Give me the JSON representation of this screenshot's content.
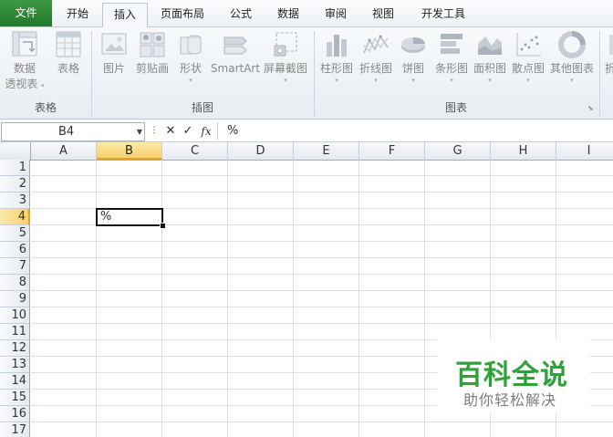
{
  "tabs": {
    "file": "文件",
    "home": "开始",
    "insert": "插入",
    "page_layout": "页面布局",
    "formulas": "公式",
    "data": "数据",
    "review": "审阅",
    "view": "视图",
    "developer": "开发工具"
  },
  "ribbon": {
    "tables": {
      "label": "表格",
      "pivot_line1": "数据",
      "pivot_line2": "透视表",
      "table": "表格"
    },
    "illustrations": {
      "label": "插图",
      "picture": "图片",
      "clipart": "剪贴画",
      "shapes": "形状",
      "smartart": "SmartArt",
      "screenshot": "屏幕截图"
    },
    "charts": {
      "label": "图表",
      "column": "柱形图",
      "line": "折线图",
      "pie": "饼图",
      "bar": "条形图",
      "area": "面积图",
      "scatter": "散点图",
      "other": "其他图表",
      "next_partial": "折"
    }
  },
  "formula_bar": {
    "name_box": "B4",
    "fx": "fx",
    "cancel": "✕",
    "enter": "✓",
    "content": "%"
  },
  "grid": {
    "columns": [
      "A",
      "B",
      "C",
      "D",
      "E",
      "F",
      "G",
      "H",
      "I"
    ],
    "rows": [
      "1",
      "2",
      "3",
      "4",
      "5",
      "6",
      "7",
      "8",
      "9",
      "10",
      "11",
      "12",
      "13",
      "14",
      "15",
      "16",
      "17"
    ],
    "selected_column": "B",
    "selected_row": "4",
    "active_cell": {
      "ref": "B4",
      "value": "%"
    }
  },
  "watermark": {
    "title": "百科全说",
    "subtitle": "助你轻松解决"
  },
  "colors": {
    "file_tab": "#24782c",
    "selection_header": "#f7d26a",
    "watermark_green": "#2fa23a"
  }
}
